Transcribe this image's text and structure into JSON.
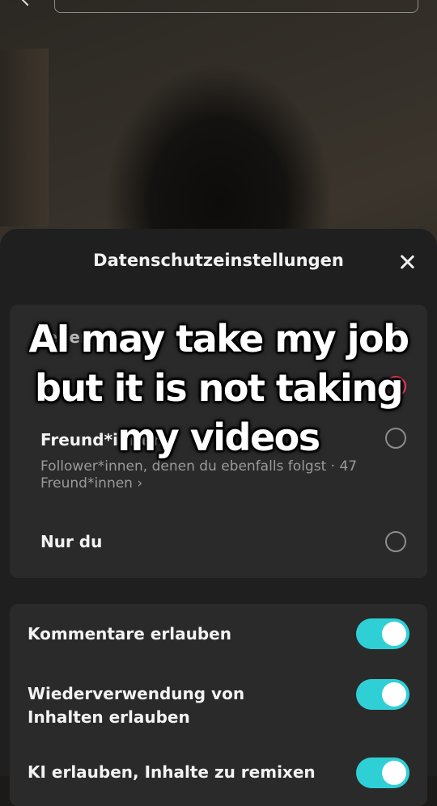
{
  "sheet": {
    "title": "Datenschutzeinstellungen"
  },
  "audience": {
    "options": [
      {
        "label": "Jeder",
        "selected": false
      },
      {
        "label": "",
        "selected": true
      },
      {
        "label": "Freund*innen",
        "sub": "Follower*innen, denen du ebenfalls folgst · 47 Freund*innen ›",
        "selected": false
      },
      {
        "label": "Nur du",
        "selected": false
      }
    ]
  },
  "toggles": [
    {
      "label": "Kommentare erlauben",
      "on": true
    },
    {
      "label": "Wiederverwendung von\nInhalten erlauben",
      "on": true
    },
    {
      "label": "KI erlauben, Inhalte zu remixen",
      "on": true
    }
  ],
  "overlay_text": "AI may take my job\nbut it is not taking\nmy videos",
  "colors": {
    "toggle_on": "#2ed0d6",
    "radio_selected": "#ff3b5c"
  }
}
